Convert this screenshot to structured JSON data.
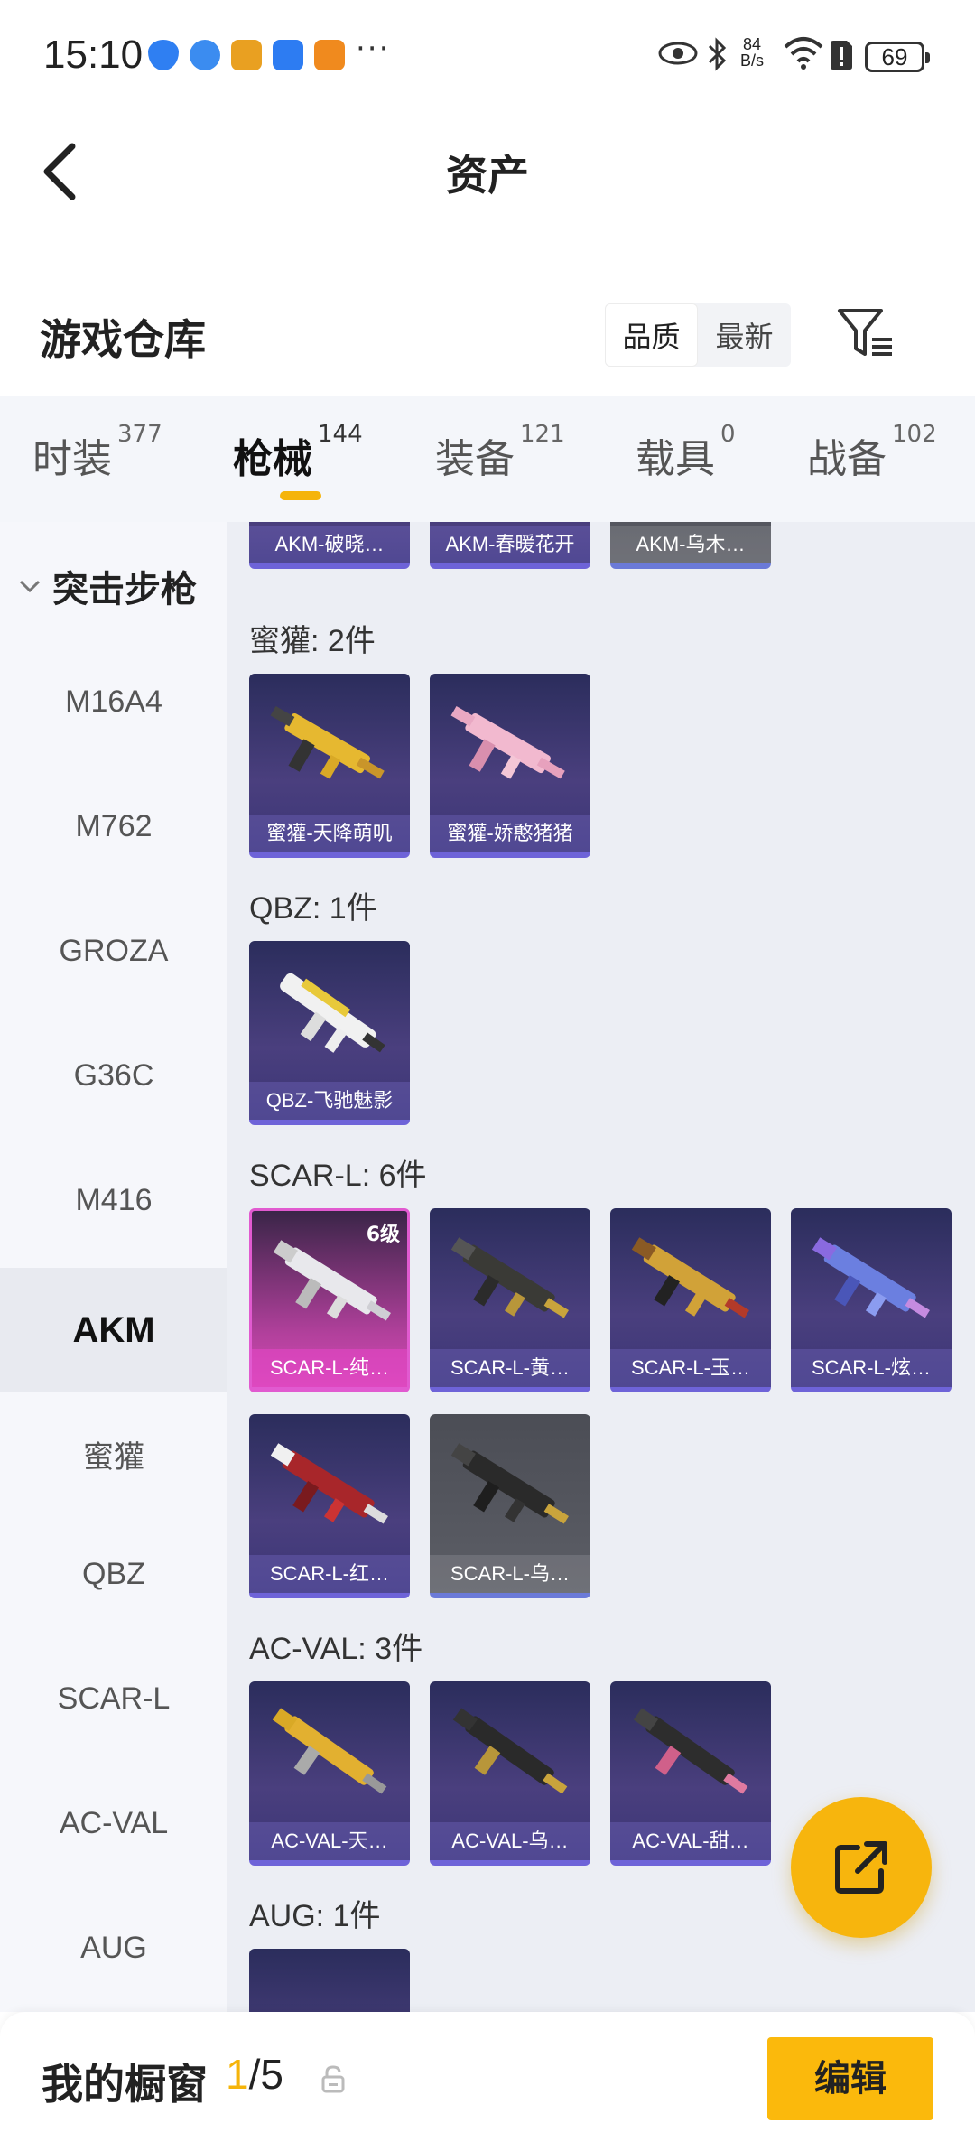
{
  "status_bar": {
    "time": "15:10",
    "net_speed_top": "84",
    "net_speed_bottom": "B/s",
    "battery": "69"
  },
  "header": {
    "title": "资产"
  },
  "warehouse": {
    "title": "游戏仓库",
    "sort_options": [
      "品质",
      "最新"
    ],
    "sort_selected": "品质"
  },
  "tabs": [
    {
      "label": "时装",
      "count": "377"
    },
    {
      "label": "枪械",
      "count": "144"
    },
    {
      "label": "装备",
      "count": "121"
    },
    {
      "label": "载具",
      "count": "0"
    },
    {
      "label": "战备",
      "count": "102"
    }
  ],
  "sidebar": {
    "category": "突击步枪",
    "items": [
      "M16A4",
      "M762",
      "GROZA",
      "G36C",
      "M416",
      "AKM",
      "蜜獾",
      "QBZ",
      "SCAR-L",
      "AC-VAL",
      "AUG"
    ],
    "active": "AKM"
  },
  "groups": [
    {
      "title": "",
      "items": [
        {
          "label": "AKM-破晓…"
        },
        {
          "label": "AKM-春暖花开"
        },
        {
          "label": "AKM-乌木…"
        }
      ]
    },
    {
      "title": "蜜獾: 2件",
      "items": [
        {
          "label": "蜜獾-天降萌叽"
        },
        {
          "label": "蜜獾-娇憨猪猪"
        }
      ]
    },
    {
      "title": "QBZ: 1件",
      "items": [
        {
          "label": "QBZ-飞驰魅影"
        }
      ]
    },
    {
      "title": "SCAR-L: 6件",
      "items": [
        {
          "label": "SCAR-L-纯…",
          "level": "6级"
        },
        {
          "label": "SCAR-L-黄…"
        },
        {
          "label": "SCAR-L-玉…"
        },
        {
          "label": "SCAR-L-炫…"
        },
        {
          "label": "SCAR-L-红…"
        },
        {
          "label": "SCAR-L-乌…"
        }
      ]
    },
    {
      "title": "AC-VAL: 3件",
      "items": [
        {
          "label": "AC-VAL-天…"
        },
        {
          "label": "AC-VAL-乌…"
        },
        {
          "label": "AC-VAL-甜…"
        }
      ]
    },
    {
      "title": "AUG: 1件",
      "items": []
    }
  ],
  "bottom": {
    "title": "我的橱窗",
    "count_current": "1",
    "count_total": "/5",
    "edit_label": "编辑"
  },
  "colors": {
    "accent": "#f5b40a",
    "card_border": "#6e63d8",
    "rare_pink": "#e15ad0"
  }
}
